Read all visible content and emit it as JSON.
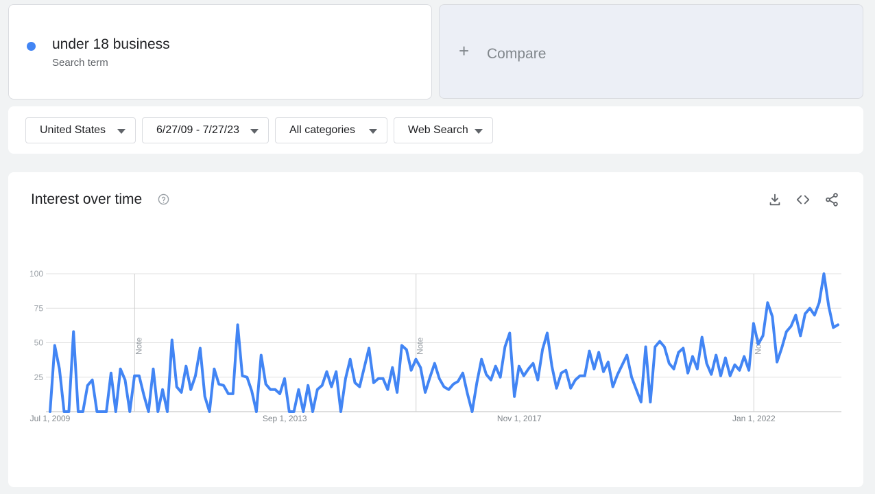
{
  "search_term": {
    "name": "under 18 business",
    "subtitle": "Search term",
    "color": "#4285f4"
  },
  "compare": {
    "plus": "+",
    "label": "Compare"
  },
  "filters": {
    "region": "United States",
    "date_range": "6/27/09 - 7/27/23",
    "category": "All categories",
    "search_type": "Web Search"
  },
  "panel": {
    "title": "Interest over time",
    "help_icon": "help-circle-icon",
    "actions": [
      "download-icon",
      "embed-code-icon",
      "share-icon"
    ]
  },
  "chart_data": {
    "type": "line",
    "title": "Interest over time",
    "xlabel": "",
    "ylabel": "",
    "ylim": [
      0,
      100
    ],
    "yticks": [
      25,
      50,
      75,
      100
    ],
    "grid": true,
    "color": "#4285f4",
    "x_tick_labels": [
      "Jul 1, 2009",
      "Sep 1, 2013",
      "Nov 1, 2017",
      "Jan 1, 2022"
    ],
    "x_tick_dates": [
      "2009-07-01",
      "2013-09-01",
      "2017-11-01",
      "2022-01-01"
    ],
    "x_range": [
      "2009-07-01",
      "2023-07-01"
    ],
    "notes": [
      {
        "label": "Note",
        "date": "2011-01-01"
      },
      {
        "label": "Note",
        "date": "2016-01-01"
      },
      {
        "label": "Note",
        "date": "2022-01-01"
      }
    ],
    "series": [
      {
        "start": "2009-07-01",
        "frequency": "monthly",
        "values": [
          0,
          48,
          31,
          0,
          0,
          58,
          0,
          0,
          19,
          23,
          0,
          0,
          0,
          28,
          0,
          31,
          23,
          0,
          26,
          26,
          12,
          0,
          31,
          0,
          16,
          0,
          52,
          18,
          14,
          33,
          16,
          26,
          46,
          11,
          0,
          31,
          20,
          19,
          13,
          13,
          63,
          26,
          25,
          15,
          0,
          41,
          20,
          16,
          16,
          13,
          24,
          0,
          0,
          16,
          0,
          19,
          0,
          16,
          19,
          29,
          18,
          29,
          0,
          24,
          38,
          21,
          18,
          32,
          46,
          21,
          24,
          24,
          16,
          32,
          14,
          48,
          45,
          30,
          38,
          32,
          14,
          25,
          35,
          24,
          18,
          16,
          20,
          22,
          28,
          13,
          0,
          21,
          38,
          27,
          23,
          33,
          25,
          47,
          57,
          11,
          33,
          26,
          31,
          35,
          23,
          45,
          57,
          33,
          17,
          28,
          30,
          17,
          23,
          26,
          26,
          44,
          31,
          43,
          29,
          36,
          18,
          27,
          34,
          41,
          25,
          16,
          7,
          47,
          7,
          47,
          51,
          47,
          35,
          31,
          43,
          46,
          28,
          40,
          31,
          54,
          35,
          27,
          41,
          26,
          39,
          26,
          34,
          30,
          40,
          30,
          64,
          49,
          55,
          79,
          69,
          36,
          46,
          58,
          62,
          70,
          55,
          71,
          75,
          70,
          79,
          100,
          77,
          61,
          63
        ]
      }
    ]
  }
}
